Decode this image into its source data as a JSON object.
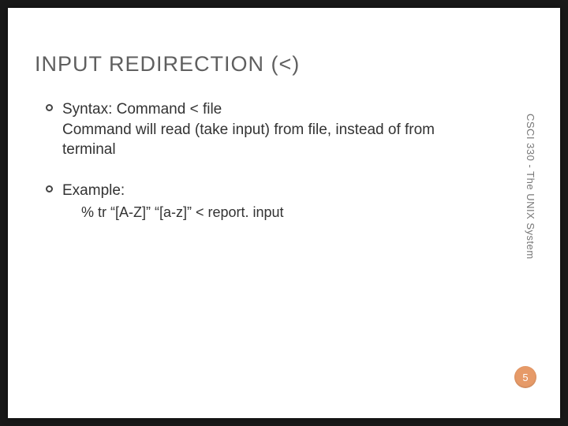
{
  "slide": {
    "title": "INPUT REDIRECTION (<)",
    "side_label": "CSCI 330 - The UNIX System",
    "page_number": "5",
    "bullets": [
      {
        "line1": "Syntax: Command < file",
        "line2": "Command will read (take input) from file, instead of from terminal"
      },
      {
        "line1": "Example:",
        "sub": "% tr “[A-Z]” “[a-z]” < report. input"
      }
    ]
  }
}
